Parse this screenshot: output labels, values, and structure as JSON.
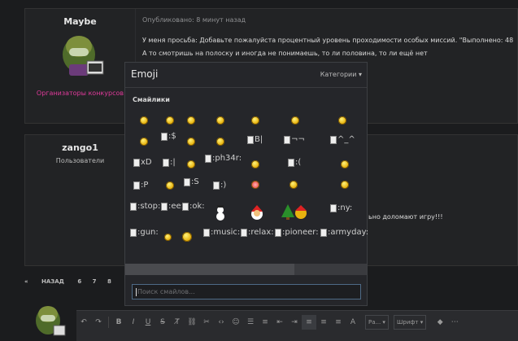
{
  "post1": {
    "username": "Maybe",
    "group": "Организаторы конкурсов",
    "group_color": "#e03a9b",
    "meta": "Опубликовано: 8 минут назад",
    "line1": "У меня просьба: Добавьте пожалуйста процентный уровень проходимости особых миссий. \"Выполнено: 48",
    "line2": "А то смотришь на полоску и иногда не понимаешь, то ли половина, то ли ещё нет"
  },
  "post2": {
    "username": "zango1",
    "group": "Пользователи",
    "fragment": "ьно доломают игру!!!"
  },
  "pager": {
    "back": "«",
    "back_label": "НАЗАД",
    "pages": [
      "6",
      "7",
      "8"
    ]
  },
  "editor": {
    "font_size_label": "Ра...",
    "font_label": "Шрифт"
  },
  "emoji_popup": {
    "title": "Emoji",
    "categories_label": "Категории",
    "section_title": "Смайлики",
    "search_placeholder": "Поиск смайлов...",
    "broken_labels": {
      "b1": ":$",
      "b2": "B|",
      "b3": "¬¬",
      "b4": "^_^",
      "b5": "xD",
      "b6": ":|",
      "b7": ":ph34r:",
      "b8": ":(",
      "b9": ":P",
      "b10": ":S",
      "b11": ":)",
      "b12": ":stop:",
      "b13": ":ee:",
      "b14": ":ok:",
      "b15": ":ny:",
      "b16": ":gun:",
      "b17": ":music:",
      "b18": ":relax:",
      "b19": ":pioneer:",
      "b20": ":armyday:"
    }
  }
}
